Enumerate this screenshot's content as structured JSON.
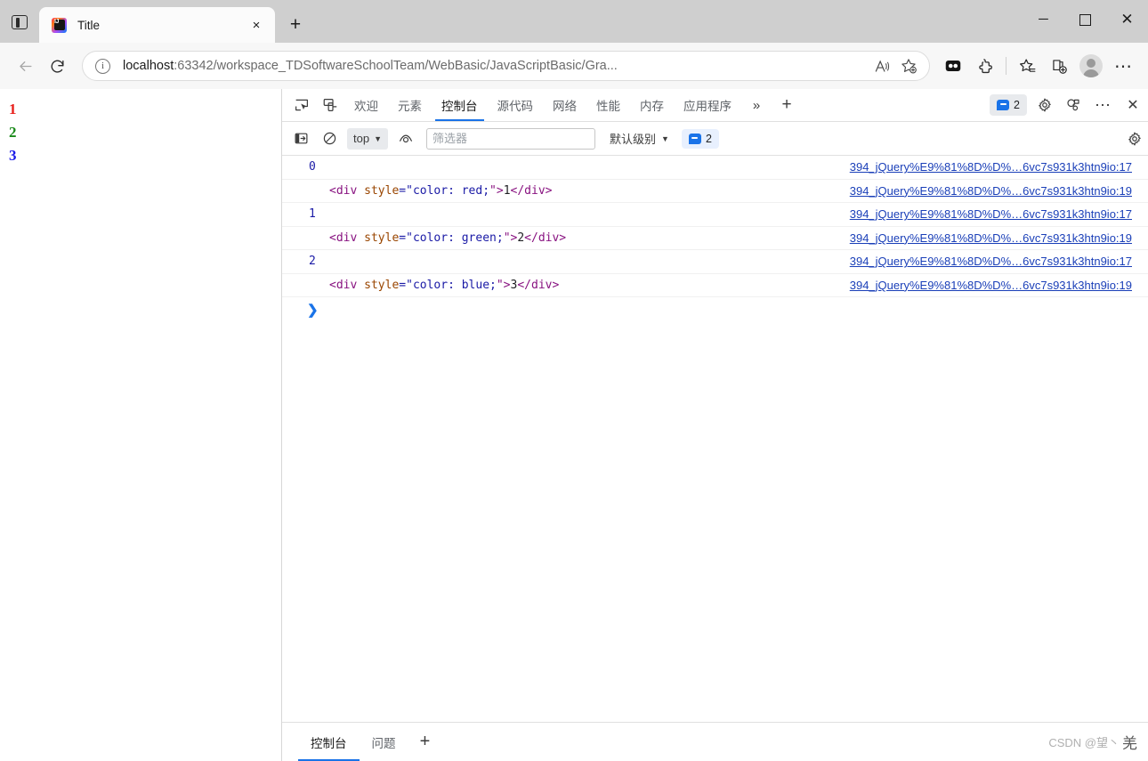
{
  "window": {
    "controls": {
      "minimize": "minimize-icon",
      "maximize": "maximize-icon",
      "close": "close-icon"
    },
    "sidebar_toggle": "sidebar-toggle-icon"
  },
  "tabstrip": {
    "tab_title": "Title",
    "tab_close_label": "×",
    "new_tab_label": "+"
  },
  "navbar": {
    "back_label": "←",
    "reload_label": "⟳",
    "url_host": "localhost",
    "url_rest": ":63342/workspace_TDSoftwareSchoolTeam/WebBasic/JavaScriptBasic/Gra...",
    "read_aloud_icon": "read-aloud-icon",
    "favorites_icon": "add-favorite-icon",
    "split_screen_icon": "split-screen-icon",
    "extensions_icon": "extensions-icon",
    "collections_icon": "collections-icon",
    "favorites_bar_icon": "favorites-icon",
    "profile_icon": "profile-avatar",
    "settings_more_label": "⋯"
  },
  "page": {
    "lines": [
      {
        "text": "1",
        "color": "#e8211c"
      },
      {
        "text": "2",
        "color": "#1a8a1a"
      },
      {
        "text": "3",
        "color": "#1a1ae8"
      }
    ]
  },
  "devtools": {
    "inspect_icon": "inspect-element-icon",
    "device_icon": "device-toolbar-icon",
    "tabs": [
      {
        "label": "欢迎",
        "active": false
      },
      {
        "label": "元素",
        "active": false
      },
      {
        "label": "控制台",
        "active": true
      },
      {
        "label": "源代码",
        "active": false
      },
      {
        "label": "网络",
        "active": false
      },
      {
        "label": "性能",
        "active": false
      },
      {
        "label": "内存",
        "active": false
      },
      {
        "label": "应用程序",
        "active": false
      }
    ],
    "more_tabs_label": "»",
    "add_tab_label": "+",
    "issues_count": "2",
    "settings_icon": "gear-icon",
    "customize_icon": "devtools-customize-icon",
    "more_options_label": "⋯",
    "close_label": "✕",
    "filterbar": {
      "sidebar_icon": "console-sidebar-icon",
      "clear_icon": "clear-console-icon",
      "context_value": "top",
      "eye_icon": "live-expression-icon",
      "filter_placeholder": "筛选器",
      "filter_value": "",
      "levels_label": "默认级别",
      "issues_count": "2",
      "settings_icon": "console-settings-icon"
    }
  },
  "console_rows": [
    {
      "type": "number",
      "value": "0",
      "source": "394_jQuery%E9%81%8D%D%…6vc7s931k3htn9io:17"
    },
    {
      "type": "html",
      "tag_open_lt": "<div",
      "space": " ",
      "attr": "style",
      "eq_quote": "=\"",
      "attr_value": "color: red;",
      "quote_gt": "\">",
      "text": "1",
      "tag_close": "</div>",
      "source": "394_jQuery%E9%81%8D%D%…6vc7s931k3htn9io:19"
    },
    {
      "type": "number",
      "value": "1",
      "source": "394_jQuery%E9%81%8D%D%…6vc7s931k3htn9io:17"
    },
    {
      "type": "html",
      "tag_open_lt": "<div",
      "space": " ",
      "attr": "style",
      "eq_quote": "=\"",
      "attr_value": "color: green;",
      "quote_gt": "\">",
      "text": "2",
      "tag_close": "</div>",
      "source": "394_jQuery%E9%81%8D%D%…6vc7s931k3htn9io:19"
    },
    {
      "type": "number",
      "value": "2",
      "source": "394_jQuery%E9%81%8D%D%…6vc7s931k3htn9io:17"
    },
    {
      "type": "html",
      "tag_open_lt": "<div",
      "space": " ",
      "attr": "style",
      "eq_quote": "=\"",
      "attr_value": "color: blue;",
      "quote_gt": "\">",
      "text": "3",
      "tag_close": "</div>",
      "source": "394_jQuery%E9%81%8D%D%…6vc7s931k3htn9io:19"
    }
  ],
  "prompt": {
    "chevron": "❯"
  },
  "drawer": {
    "tabs": [
      {
        "label": "控制台",
        "active": true
      },
      {
        "label": "问题",
        "active": false
      }
    ],
    "add_label": "+"
  },
  "watermark": {
    "text": "CSDN @望丶",
    "mark": "羌"
  },
  "colors": {
    "accent": "#1a73e8",
    "link": "#1a3fb8",
    "tag": "#881280",
    "attr": "#994500",
    "value": "#1a1aa6"
  }
}
